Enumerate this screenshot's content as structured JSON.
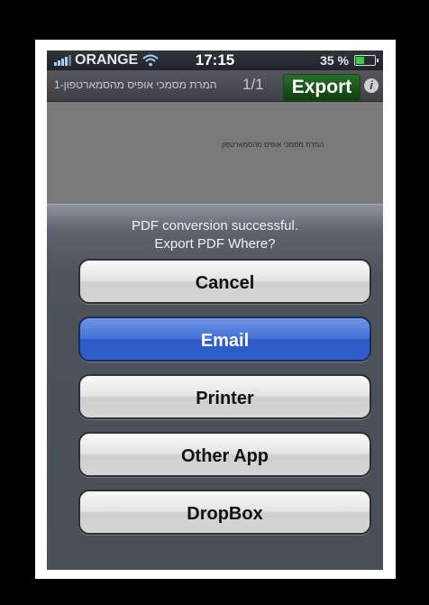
{
  "statusbar": {
    "carrier": "ORANGE",
    "time": "17:15",
    "battery": "35 %",
    "battery_level": 0.35
  },
  "navbar": {
    "doc_title": "המרת מסמכי אופיס מהסמארטפון-1",
    "page_indicator": "1/1",
    "export_label": "Export",
    "info_label": "i"
  },
  "document": {
    "preview_text": "המרת מסמכי אופיס מהסמארטפון"
  },
  "sheet": {
    "message_line1": "PDF conversion successful.",
    "message_line2": "Export PDF Where?",
    "buttons": [
      "Cancel",
      "Email",
      "Printer",
      "Other App",
      "DropBox"
    ]
  },
  "colors": {
    "primary_button": "#3a68d2",
    "export_button": "#1f5a20"
  }
}
